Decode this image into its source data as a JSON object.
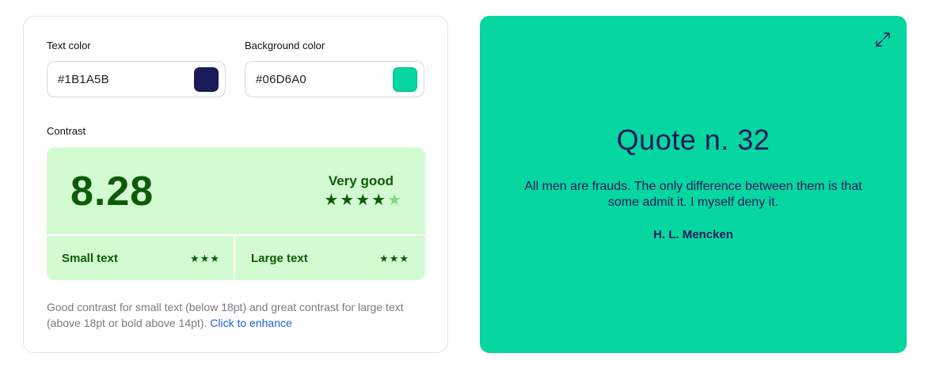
{
  "text_color": {
    "label": "Text color",
    "value": "#1B1A5B",
    "swatch": "#1B1A5B"
  },
  "background_color": {
    "label": "Background color",
    "value": "#06D6A0",
    "swatch": "#06D6A0"
  },
  "contrast": {
    "label": "Contrast",
    "ratio": "8.28",
    "rating": "Very good",
    "stars_total": 5,
    "stars_filled": 4,
    "small_text": {
      "label": "Small text",
      "stars": 3
    },
    "large_text": {
      "label": "Large text",
      "stars": 3
    },
    "accent_color": "#0e5a0a",
    "box_color": "#d3fbd1"
  },
  "description": {
    "text": "Good contrast for small text (below 18pt) and great contrast for large text (above 18pt or bold above 14pt).",
    "link": "Click to enhance"
  },
  "preview": {
    "title": "Quote n. 32",
    "quote": "All men are frauds. The only difference between them is that some admit it. I myself deny it.",
    "author": "H. L. Mencken",
    "icon": "expand-icon"
  }
}
